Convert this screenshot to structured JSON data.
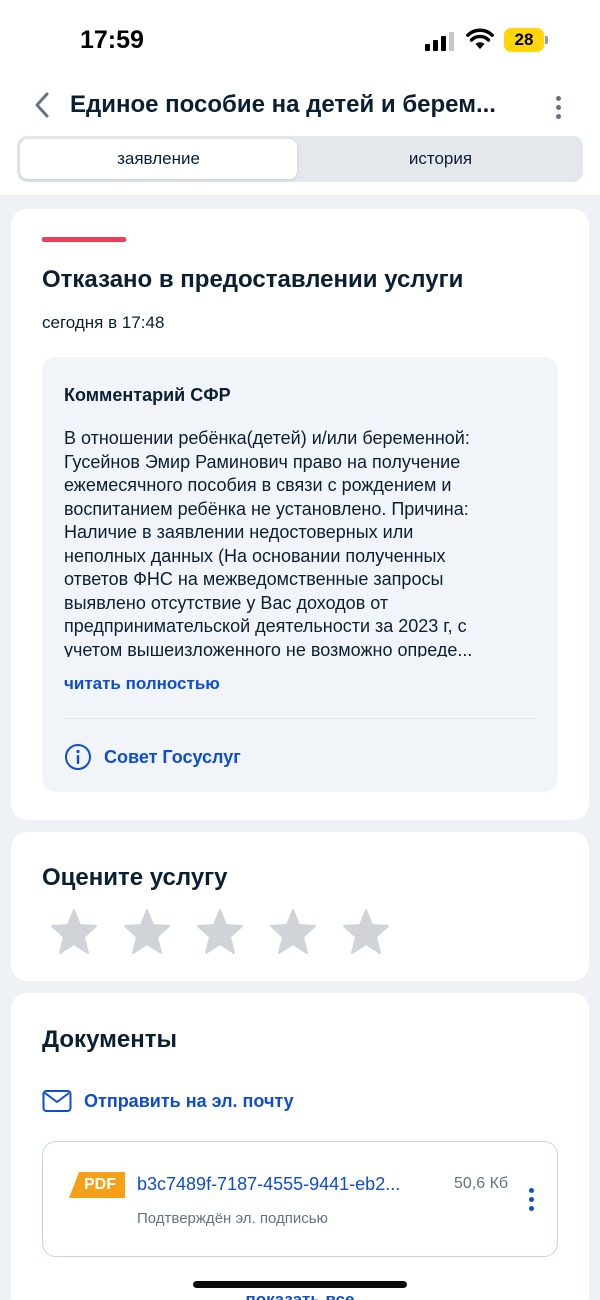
{
  "status_bar": {
    "time": "17:59",
    "battery_level": "28",
    "icons": [
      "signal-icon",
      "wifi-icon",
      "battery-icon"
    ]
  },
  "header": {
    "title": "Единое пособие на детей и берем...",
    "back_icon": "chevron-left-icon",
    "menu_icon": "kebab-menu-icon"
  },
  "tabs": [
    {
      "label": "заявление",
      "active": true
    },
    {
      "label": "история",
      "active": false
    }
  ],
  "status_card": {
    "status_color": "#ee3f58",
    "title": "Отказано в предоставлении услуги",
    "date": "сегодня в 17:48",
    "comment": {
      "title": "Комментарий СФР",
      "lines": [
        "В отношении ребёнка(детей) и/или беременной:",
        "Гусейнов Эмир Раминович право на получение",
        "ежемесячного пособия в связи с рождением и",
        "воспитанием ребёнка не установлено. Причина:",
        "Наличие в заявлении недостоверных или",
        "неполных данных (На основании полученных",
        "ответов ФНС на межведомственные запросы",
        "выявлено отсутствие у Вас доходов от",
        "предпринимательской деятельности за 2023 г, с",
        "учетом вышеизложенного не возможно опреде..."
      ],
      "read_more": "читать полностью",
      "advice_label": "Совет Госуслуг",
      "advice_icon": "info-circle-icon"
    }
  },
  "rating": {
    "title": "Оцените услугу",
    "max_stars": 5,
    "selected": 0,
    "star_icon": "star-icon"
  },
  "documents": {
    "title": "Документы",
    "email_label": "Отправить на эл. почту",
    "email_icon": "envelope-icon",
    "files": [
      {
        "type": "PDF",
        "name": "b3c7489f-7187-4555-9441-eb2...",
        "size": "50,6 Кб",
        "signature": "Подтверждён эл. подписью"
      }
    ],
    "show_all": "показать все"
  },
  "colors": {
    "accent": "#0d4cd3",
    "text": "#0b1f33",
    "secondary_text": "#66727f",
    "error": "#ee3f58",
    "pdf": "#f6a01a",
    "battery": "#ffd60a",
    "star_inactive": "#d0d3d8"
  }
}
